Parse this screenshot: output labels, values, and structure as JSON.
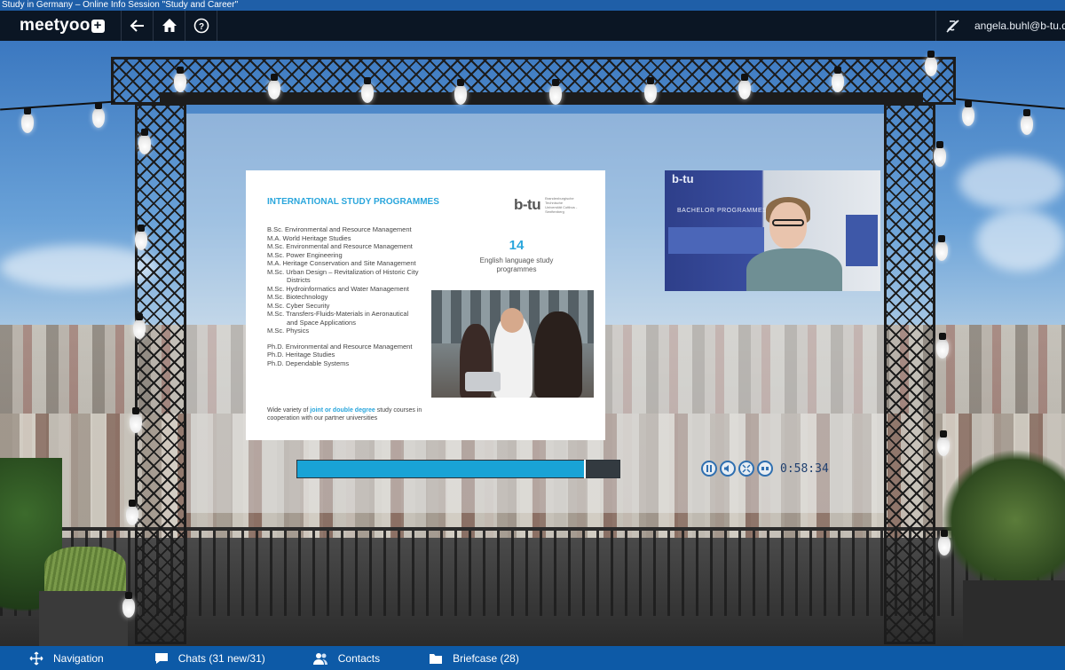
{
  "window": {
    "title": "Study in Germany – Online Info Session \"Study and Career\""
  },
  "topbar": {
    "logo_text": "meetyoo",
    "user_email": "angela.buhl@b-tu.de"
  },
  "slide": {
    "title": "INTERNATIONAL STUDY PROGRAMMES",
    "logo_mark": "b-tu",
    "logo_sub": "Brandenburgische Technische Universität Cottbus - Senftenberg",
    "programmes": [
      "B.Sc.  Environmental and Resource Management",
      "M.A.   World Heritage Studies",
      "M.Sc. Environmental and Resource Management",
      "M.Sc. Power Engineering",
      "M.A.   Heritage Conservation and Site Management",
      "M.Sc. Urban Design – Revitalization of Historic City",
      "Districts",
      "M.Sc. Hydroinformatics and Water Management",
      "M.Sc. Biotechnology",
      "M.Sc. Cyber Security",
      "M.Sc. Transfers-Fluids-Materials in Aeronautical",
      "and Space Applications",
      "M.Sc.  Physics"
    ],
    "phd": [
      "Ph.D. Environmental and Resource Management",
      "Ph.D. Heritage Studies",
      "Ph.D. Dependable Systems"
    ],
    "count": "14",
    "count_label_1": "English language study",
    "count_label_2": "programmes",
    "footer_pre": "Wide variety of ",
    "footer_hl": "joint or double degree",
    "footer_post": " study courses in cooperation with our partner universities"
  },
  "webcam": {
    "banner_logo": "b-tu",
    "banner_text": "BACHELOR PROGRAMMES"
  },
  "player": {
    "progress": 0.89,
    "timecode": "0:58:34"
  },
  "bottombar": {
    "navigation": "Navigation",
    "chats": "Chats (31 new/31)",
    "contacts": "Contacts",
    "briefcase": "Briefcase (28)"
  },
  "colors": {
    "accent": "#19a3d6",
    "bottombar": "#0d5aa7",
    "topbar": "#0b1624"
  }
}
